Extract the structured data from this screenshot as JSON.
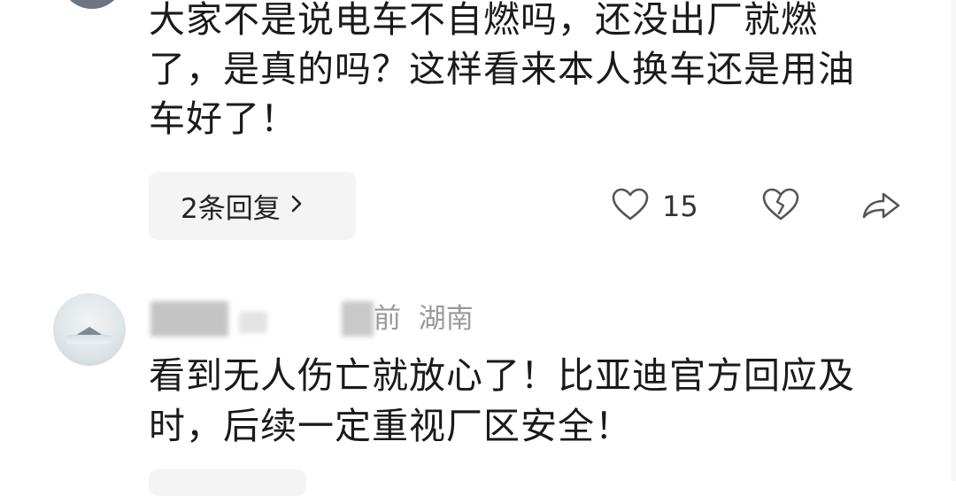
{
  "comments": [
    {
      "text": "大家不是说电车不自燃吗，还没出厂就燃了，是真的吗？这样看来本人换车还是用油车好了！",
      "reply_button_label": "2条回复",
      "like_count": "15"
    },
    {
      "meta_text": "前  湖南",
      "text": "看到无人伤亡就放心了！比亚迪官方回应及时，后续一定重视厂区安全！"
    }
  ],
  "icons": {
    "like": "heart-outline-icon",
    "dislike": "broken-heart-icon",
    "share": "share-arrow-icon",
    "reply_chevron": "chevron-right-icon"
  }
}
